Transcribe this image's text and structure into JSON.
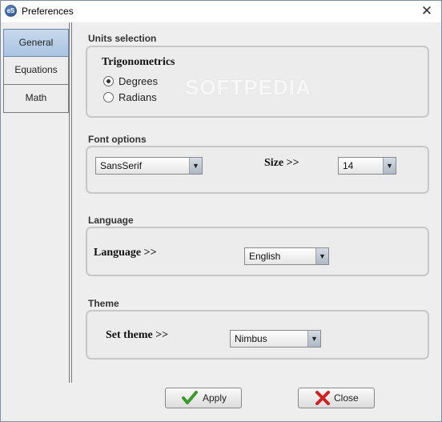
{
  "window": {
    "title": "Preferences",
    "app_icon_text": "eS",
    "close_glyph": "✕"
  },
  "tabs": [
    {
      "label": "General",
      "selected": true
    },
    {
      "label": "Equations",
      "selected": false
    },
    {
      "label": "Math",
      "selected": false
    }
  ],
  "units": {
    "section_title": "Units selection",
    "heading": "Trigonometrics",
    "options": [
      {
        "label": "Degrees",
        "checked": true
      },
      {
        "label": "Radians",
        "checked": false
      }
    ]
  },
  "font": {
    "section_title": "Font options",
    "family_value": "SansSerif",
    "size_label": "Size >>",
    "size_value": "14"
  },
  "language": {
    "section_title": "Language",
    "label": "Language  >>",
    "value": "English"
  },
  "theme": {
    "section_title": "Theme",
    "label": "Set theme  >>",
    "value": "Nimbus"
  },
  "buttons": {
    "apply_label": "Apply",
    "close_label": "Close"
  },
  "watermark": "SOFTPEDIA",
  "colors": {
    "apply_check": "#3a9a2a",
    "close_x": "#cc2222",
    "tab_selected": "#aac4e2"
  }
}
